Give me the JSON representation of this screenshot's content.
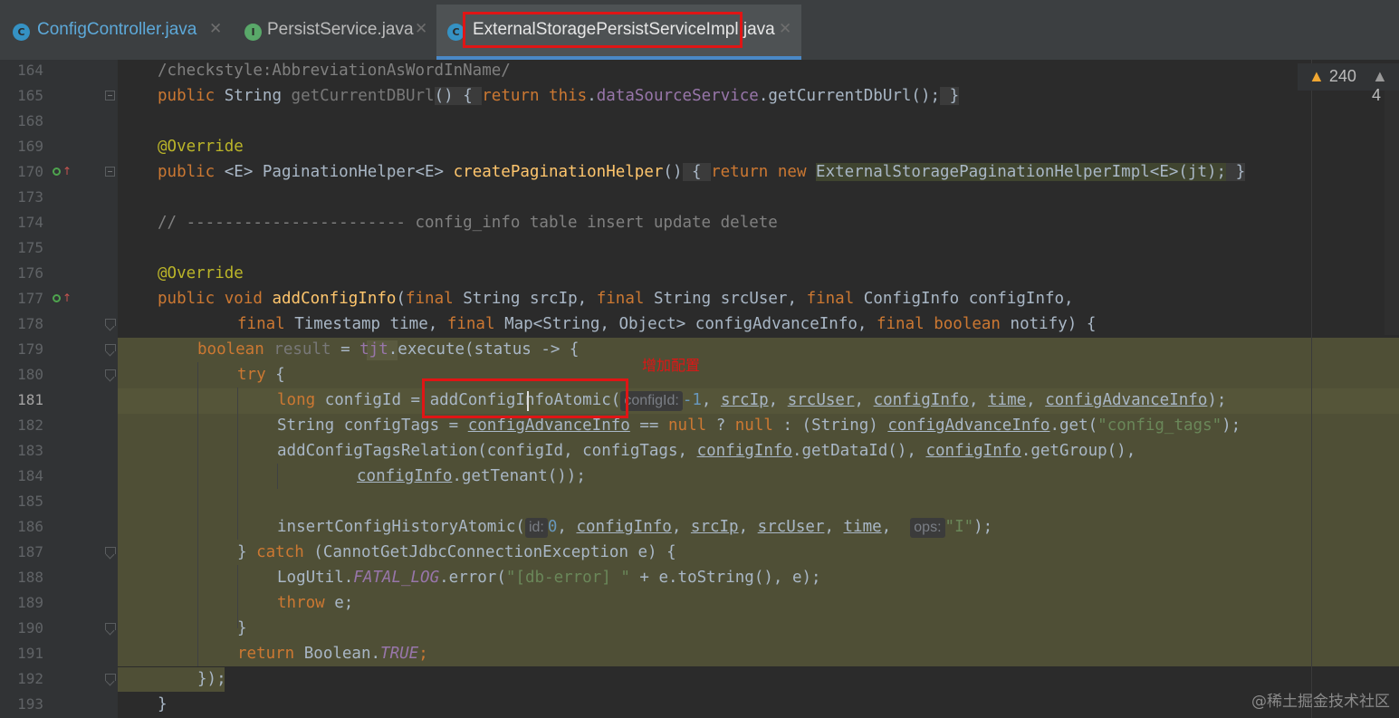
{
  "tabs": [
    {
      "label": "ConfigController.java",
      "icon": "C",
      "icon_color": "#3592c4",
      "label_color": "#5da9d9"
    },
    {
      "label": "PersistService.java",
      "icon": "I",
      "icon_color": "#59a869",
      "label_color": "#bbbbbb"
    },
    {
      "label": "ExternalStoragePersistServiceImpl.java",
      "icon": "C",
      "icon_color": "#3592c4",
      "label_color": "#e6e6e6",
      "active": true
    }
  ],
  "inspection": {
    "warnings_a": "240",
    "warnings_b": "4"
  },
  "line_numbers": [
    "164",
    "165",
    "168",
    "169",
    "170",
    "173",
    "174",
    "175",
    "176",
    "177",
    "178",
    "179",
    "180",
    "181",
    "182",
    "183",
    "184",
    "185",
    "186",
    "187",
    "188",
    "189",
    "190",
    "191",
    "192",
    "193"
  ],
  "current_line": "181",
  "code": {
    "l164": "/checkstyle:AbbreviationAsWordInName/",
    "l165": {
      "kw": "public",
      "type": "String",
      "name": "getCurrentDBUrl",
      "body": " { ",
      "ret": "return",
      "this": "this",
      "field": "dataSourceService",
      "call": ".getCurrentDbUrl();",
      "close": " }"
    },
    "l169": "@Override",
    "l170": {
      "kw": "public",
      "gen": " <E> PaginationHelper<E> ",
      "name": "createPaginationHelper",
      "ret": "return",
      "new": "new",
      "cls": "ExternalStoragePaginationHelperImpl<E>(jt);",
      "close": " }"
    },
    "l174": "// ----------------------- config_info table insert update delete",
    "l176": "@Override",
    "l177": {
      "kw1": "public",
      "kw2": "void",
      "name": "addConfigInfo",
      "p1": "final",
      "t1": "String srcIp,",
      "p2": "final",
      "t2": "String srcUser,",
      "p3": "final",
      "t3": "ConfigInfo configInfo,"
    },
    "l178": {
      "p1": "final",
      "t1": "Timestamp time,",
      "p2": "final",
      "t2": "Map<String, Object> configAdvanceInfo,",
      "p3": "final",
      "p4": "boolean",
      "t3": "notify) {"
    },
    "l179": {
      "kw": "boolean",
      "var": "result",
      "eq": " = ",
      "tjt": "tjt",
      "rest": ".execute(status -> {"
    },
    "l180": {
      "kw": "try",
      "rest": " {"
    },
    "l181": {
      "kw": "long",
      "var": "configId",
      "eq": " = ",
      "call": "addConfigInfoAtomic(",
      "hint": "configId:",
      "num": "-1",
      "a1": "srcIp",
      "a2": "srcUser",
      "a3": "configInfo",
      "a4": "time",
      "a5": "configAdvanceInfo",
      "end": ");"
    },
    "l182": {
      "t": "String configTags = ",
      "u1": "configAdvanceInfo",
      "mid1": " == ",
      "null1": "null",
      "q": " ? ",
      "null2": "null",
      "mid2": " : (String) ",
      "u2": "configAdvanceInfo",
      "get": ".get(",
      "str": "\"config_tags\"",
      "end": ");"
    },
    "l183": {
      "call": "addConfigTagsRelation(configId, configTags, ",
      "u1": "configInfo",
      "m1": ".getDataId(), ",
      "u2": "configInfo",
      "m2": ".getGroup(),"
    },
    "l184": {
      "u1": "configInfo",
      "m1": ".getTenant());"
    },
    "l186": {
      "call": "insertConfigHistoryAtomic(",
      "hint1": "id:",
      "num": "0",
      "a1": "configInfo",
      "a2": "srcIp",
      "a3": "srcUser",
      "a4": "time",
      "hint2": "ops:",
      "str": "\"I\"",
      "end": ");"
    },
    "l187": {
      "b": "} ",
      "kw": "catch",
      "rest": " (CannotGetJdbcConnectionException e) {"
    },
    "l188": {
      "cls": "LogUtil.",
      "fld": "FATAL_LOG",
      "call": ".error(",
      "str": "\"[db-error] \"",
      "rest": " + e.toString(), e);"
    },
    "l189": {
      "kw": "throw",
      "rest": " e;"
    },
    "l190": "}",
    "l191": {
      "kw": "return",
      "rest": " Boolean.",
      "fld": "TRUE",
      "end": ";"
    },
    "l192": "});",
    "l193": "}"
  },
  "annotation_label": "增加配置",
  "watermark": "@稀土掘金技术社区",
  "colors": {
    "keyword": "#cc7832",
    "string": "#6a8759",
    "field": "#9876aa",
    "function": "#ffc66d",
    "annotation": "#bbb529",
    "comment": "#808080",
    "number": "#6897bb",
    "highlight_red": "#e01515"
  }
}
